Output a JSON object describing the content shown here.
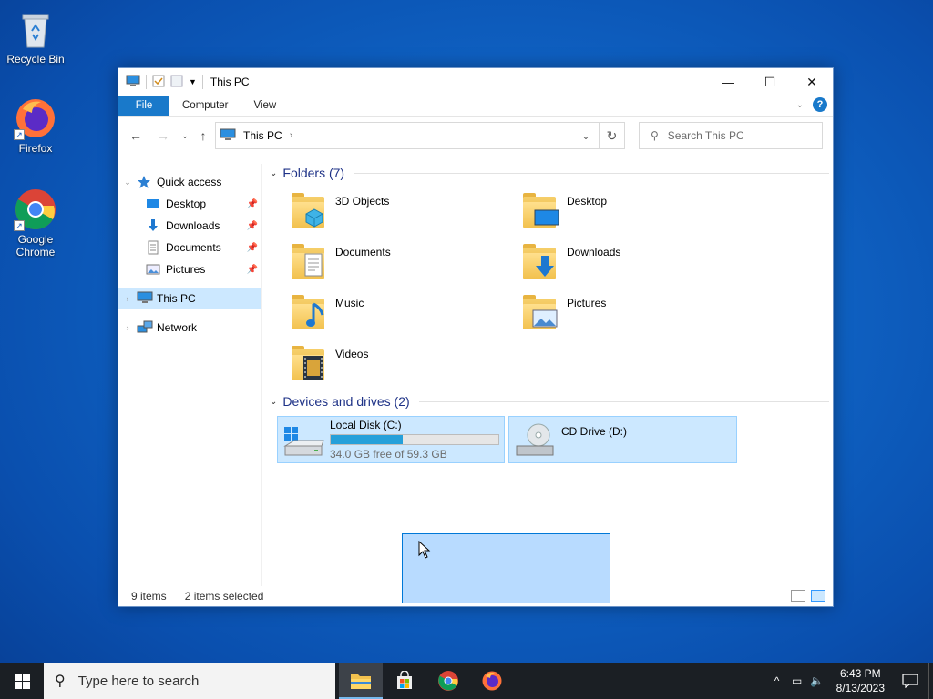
{
  "desktop": {
    "icons": [
      {
        "label": "Recycle Bin"
      },
      {
        "label": "Firefox"
      },
      {
        "label": "Google Chrome"
      }
    ]
  },
  "window": {
    "title": "This PC",
    "controls": {
      "minimize": "—",
      "maximize": "☐",
      "close": "✕"
    },
    "ribbon_tabs": [
      "File",
      "Computer",
      "View"
    ],
    "help": "?",
    "address": {
      "crumb": "This PC"
    },
    "search": {
      "placeholder": "Search This PC"
    },
    "nav": {
      "quick_access": "Quick access",
      "items": [
        "Desktop",
        "Downloads",
        "Documents",
        "Pictures"
      ],
      "this_pc": "This PC",
      "network": "Network"
    },
    "folders_header": "Folders (7)",
    "folders": [
      "3D Objects",
      "Desktop",
      "Documents",
      "Downloads",
      "Music",
      "Pictures",
      "Videos"
    ],
    "devices_header": "Devices and drives (2)",
    "drives": [
      {
        "name": "Local Disk (C:)",
        "free": "34.0 GB free of 59.3 GB",
        "used_fraction": 0.43
      },
      {
        "name": "CD Drive (D:)"
      }
    ],
    "status": {
      "items": "9 items",
      "selected": "2 items selected"
    }
  },
  "taskbar": {
    "search_placeholder": "Type here to search",
    "apps": [
      "file-explorer",
      "microsoft-store",
      "google-chrome",
      "firefox"
    ],
    "time": "6:43 PM",
    "date": "8/13/2023"
  },
  "colors": {
    "accent": "#1979ca",
    "selection": "#cce8ff",
    "header_text": "#1e3287"
  }
}
